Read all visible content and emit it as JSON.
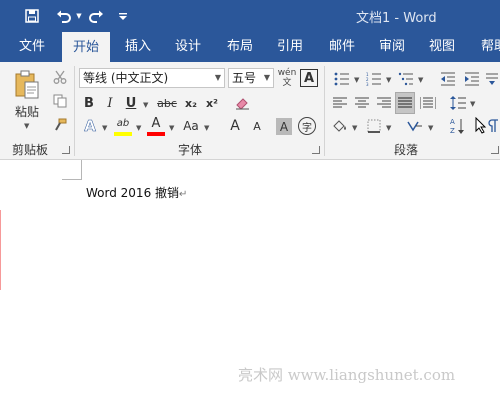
{
  "titlebar": {
    "doc_title": "文档1 - Word",
    "qat": [
      "save-icon",
      "undo-icon",
      "redo-icon",
      "customize-qat-icon"
    ]
  },
  "tabs": [
    {
      "label": "文件"
    },
    {
      "label": "开始"
    },
    {
      "label": "插入"
    },
    {
      "label": "设计"
    },
    {
      "label": "布局"
    },
    {
      "label": "引用"
    },
    {
      "label": "邮件"
    },
    {
      "label": "审阅"
    },
    {
      "label": "视图"
    },
    {
      "label": "帮助"
    }
  ],
  "active_tab": "开始",
  "clipboard": {
    "paste_label": "粘贴",
    "group_label": "剪贴板"
  },
  "font": {
    "font_name": "等线 (中文正文)",
    "font_size": "五号",
    "phonetic_glyph": "wén\n文",
    "border_char_glyph": "A",
    "bold": "B",
    "italic": "I",
    "underline": "U",
    "strikethrough": "abc",
    "subscript": "x₂",
    "superscript": "x²",
    "text_effects": "A",
    "highlight": "ab",
    "font_color": "A",
    "change_case": "Aa",
    "grow_font": "A",
    "shrink_font": "A",
    "char_shading": "A",
    "enclose_char": "字",
    "group_label": "字体"
  },
  "paragraph": {
    "group_label": "段落"
  },
  "document": {
    "text": "Word 2016  撤销",
    "para_mark": "↵"
  },
  "watermark": "亮术网 www.liangshunet.com",
  "colors": {
    "brand": "#2b579a",
    "ribbon_bg": "#f3f3f3",
    "highlight_yellow": "#ffff00",
    "font_red": "#ff0000"
  }
}
